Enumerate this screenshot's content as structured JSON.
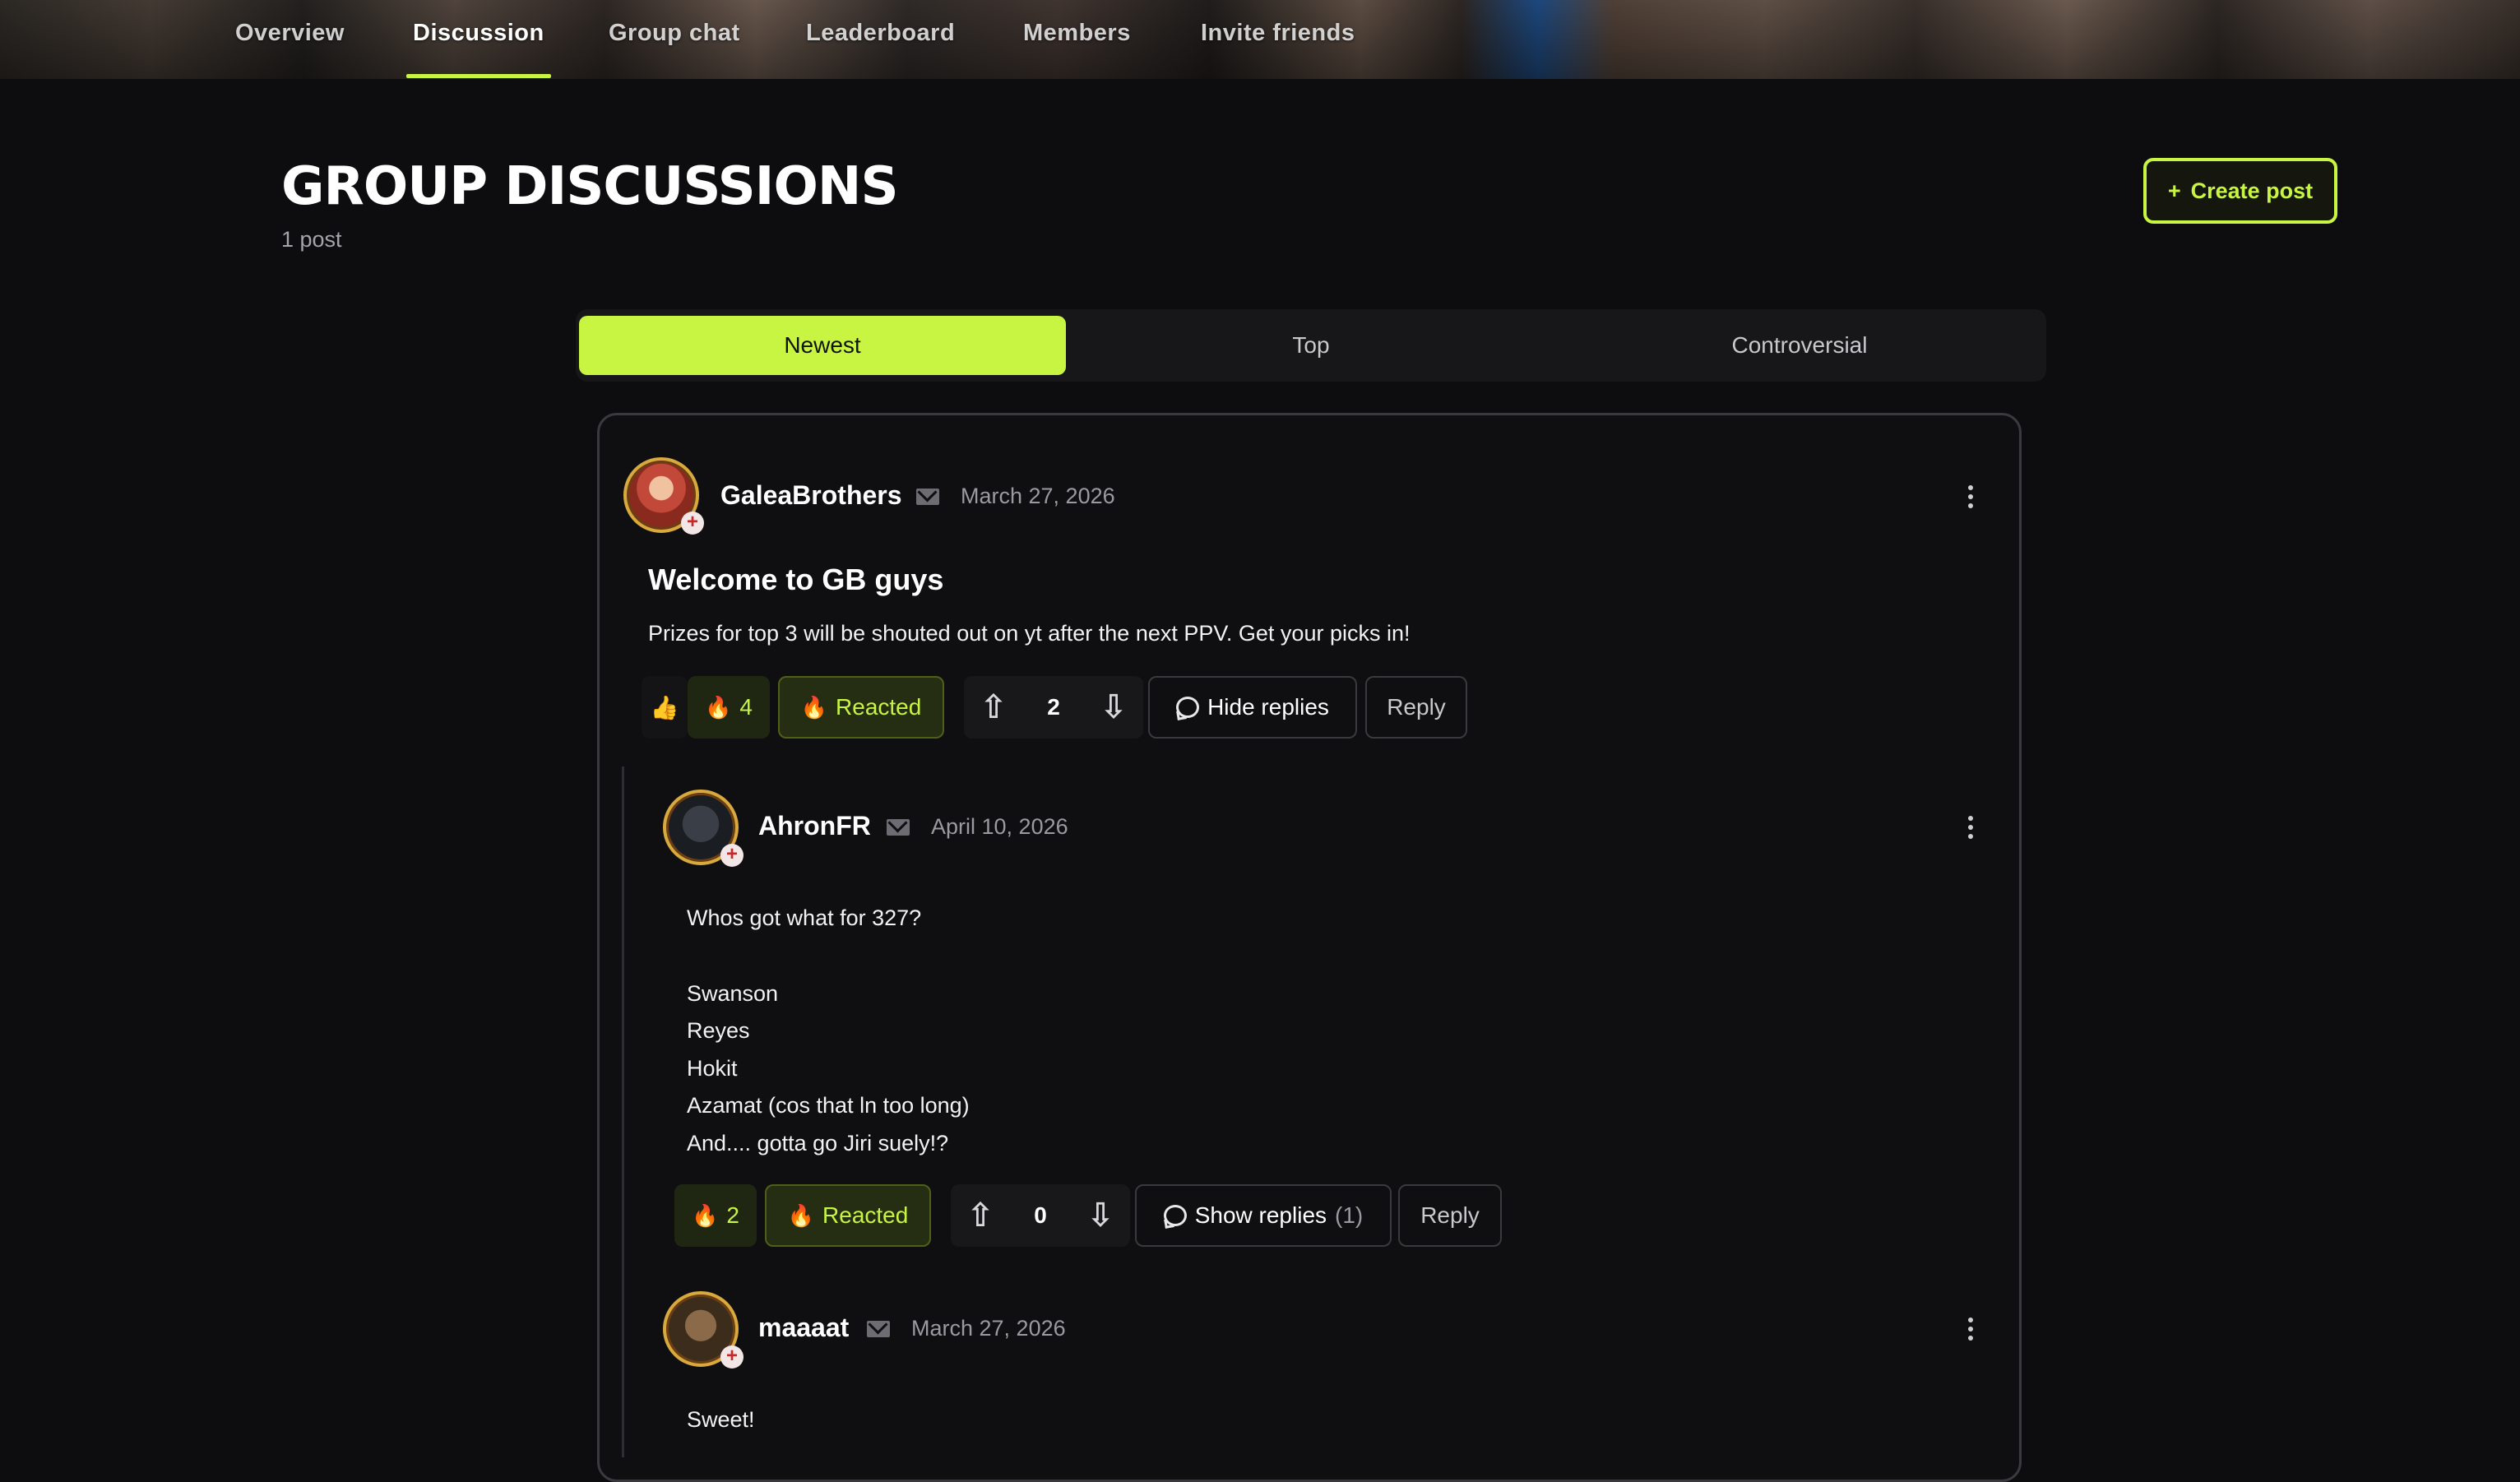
{
  "nav": {
    "items": [
      {
        "label": "Overview"
      },
      {
        "label": "Discussion"
      },
      {
        "label": "Group chat"
      },
      {
        "label": "Leaderboard"
      },
      {
        "label": "Members"
      },
      {
        "label": "Invite friends"
      }
    ],
    "active": "Discussion"
  },
  "header": {
    "title": "GROUP DISCUSSIONS",
    "post_count": "1 post",
    "create_button": "Create post",
    "create_icon": "+"
  },
  "sort_tabs": {
    "items": [
      {
        "label": "Newest"
      },
      {
        "label": "Top"
      },
      {
        "label": "Controversial"
      }
    ],
    "active": "Newest"
  },
  "post": {
    "author": "GaleaBrothers",
    "date": "March 27, 2026",
    "title": "Welcome to GB guys",
    "body": "Prizes for top 3 will be shouted out on yt after the next PPV. Get your picks in!",
    "reactions": {
      "thumbs_emoji": "👍",
      "fire_emoji": "🔥",
      "fire_count": "4",
      "reacted_label": "Reacted"
    },
    "score": "2",
    "hide_replies_label": "Hide replies",
    "reply_label": "Reply"
  },
  "replies": [
    {
      "author": "AhronFR",
      "date": "April 10, 2026",
      "lines": [
        "Whos got what for 327?",
        "",
        "Swanson",
        "Reyes",
        "Hokit",
        "Azamat (cos that ln too long)",
        "And.... gotta go Jiri suely!?"
      ],
      "fire_emoji": "🔥",
      "fire_count": "2",
      "reacted_label": "Reacted",
      "score": "0",
      "show_replies_label": "Show replies",
      "show_replies_count": "(1)",
      "reply_label": "Reply"
    },
    {
      "author": "maaaat",
      "date": "March 27, 2026",
      "lines": [
        "Sweet!"
      ]
    }
  ],
  "colors": {
    "accent": "#c8f541",
    "background": "#0d0d0f",
    "card_border": "#3a3a3e",
    "flame": "#ff7a1a"
  },
  "icons": {
    "mail": "mail-icon",
    "kebab": "more-vertical-icon",
    "upvote": "arrow-up-icon",
    "downvote": "arrow-down-icon",
    "comment": "comment-bubble-icon"
  }
}
